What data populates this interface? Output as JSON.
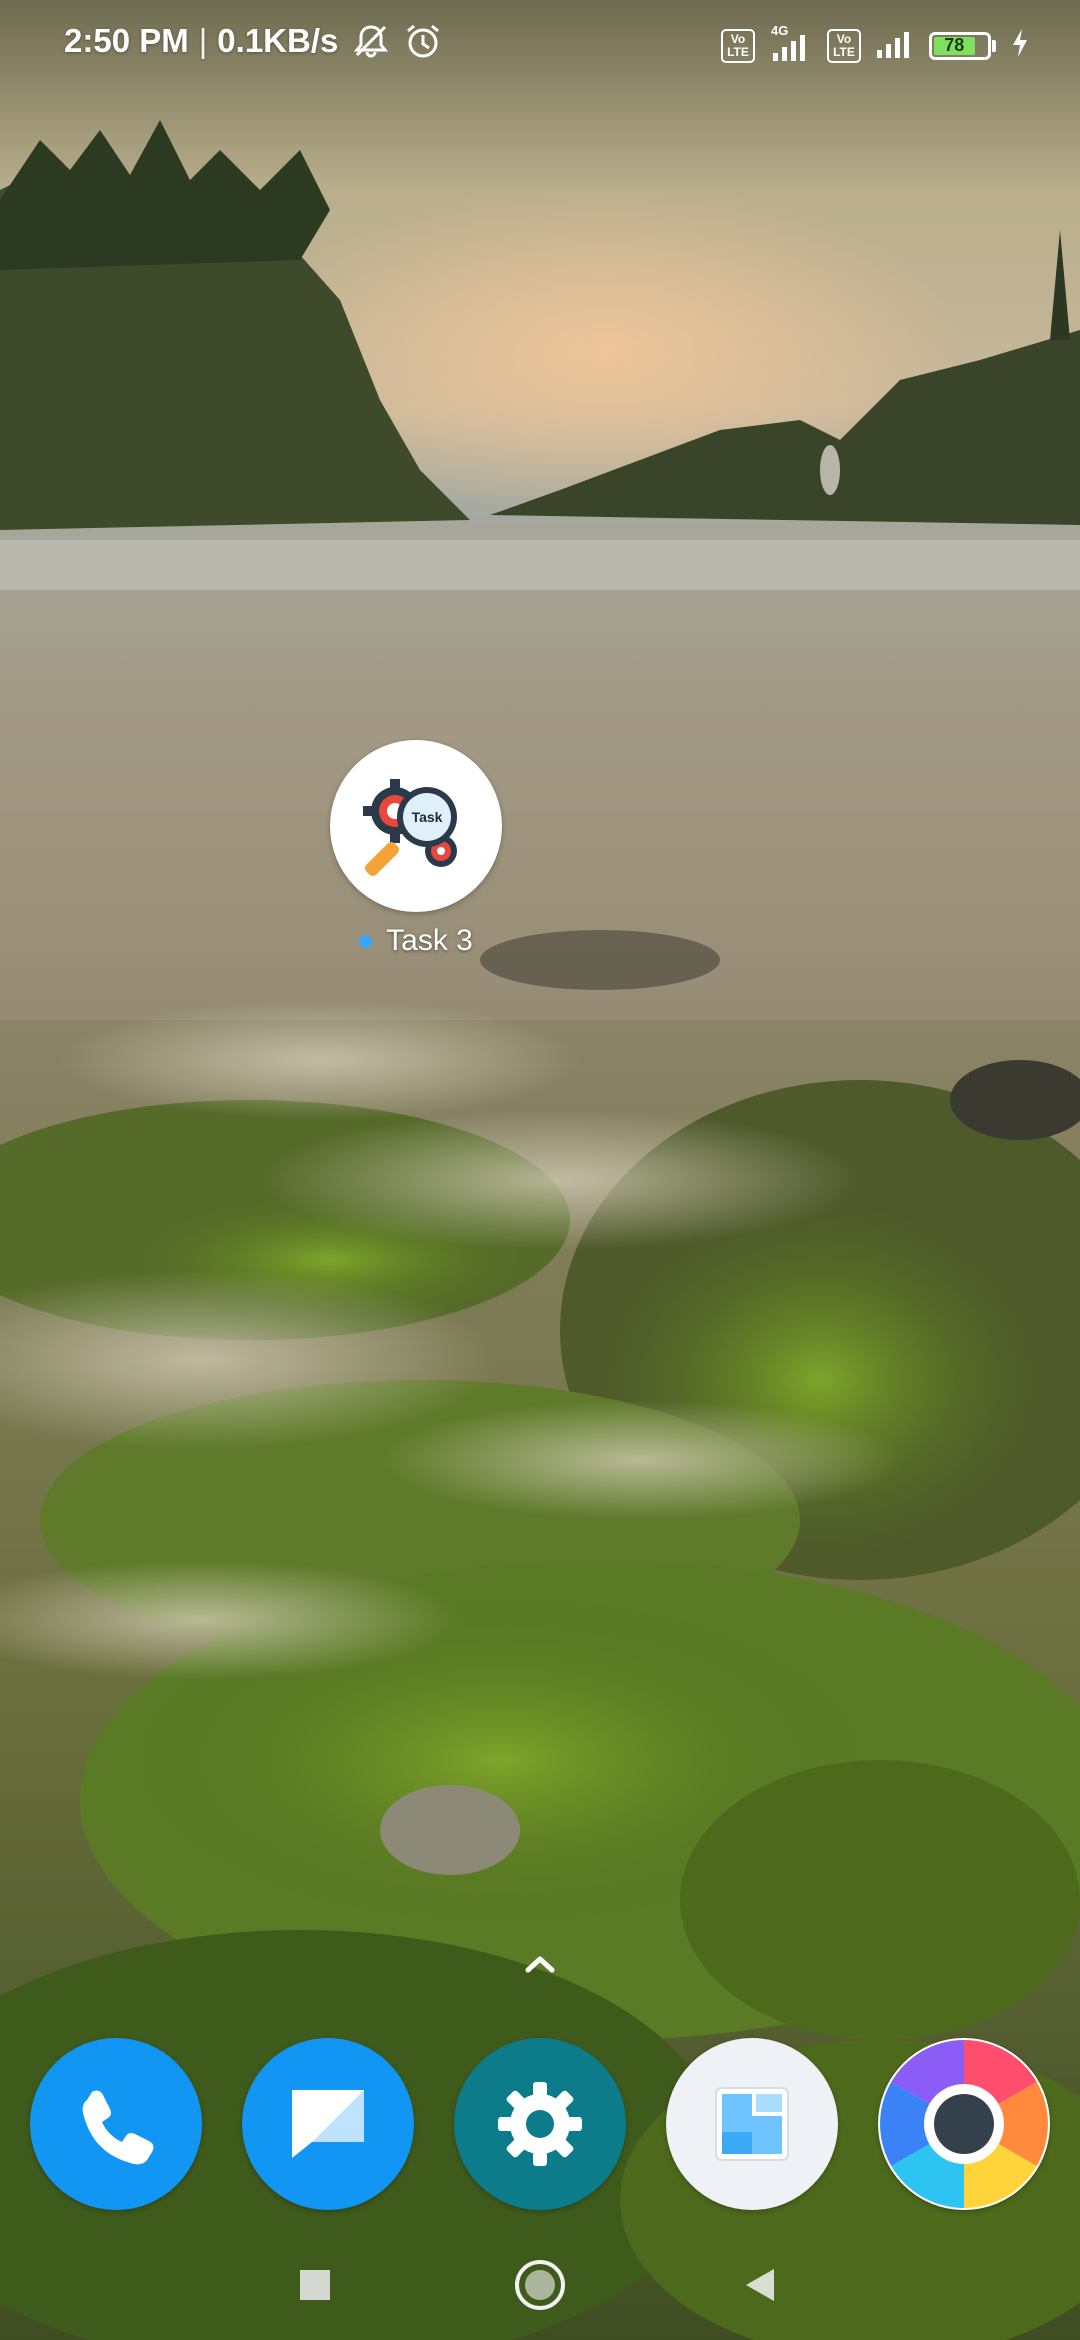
{
  "status_bar": {
    "time": "2:50 PM",
    "separator": "|",
    "net_speed": "0.1KB/s",
    "battery_level": "78",
    "icons": [
      "mute-icon",
      "alarm-icon",
      "volte-icon",
      "signal-4g-icon",
      "volte-icon",
      "signal-icon",
      "battery-icon",
      "charging-icon"
    ],
    "volte_top": "Vo",
    "volte_bottom": "LTE",
    "network_type": "4G"
  },
  "desktop": {
    "app": {
      "label": "Task 3",
      "icon": "task-gear-magnifier-icon",
      "icon_text": "Task",
      "new_indicator_color": "#37a6ff"
    }
  },
  "dock": {
    "apps": [
      {
        "name": "phone",
        "icon": "phone-icon",
        "color": "#1296f3"
      },
      {
        "name": "messages",
        "icon": "message-icon",
        "color": "#1296f3"
      },
      {
        "name": "settings",
        "icon": "gear-icon",
        "color": "#0c7b8a"
      },
      {
        "name": "gallery",
        "icon": "gallery-icon",
        "color": "#eef1f5"
      },
      {
        "name": "camera",
        "icon": "camera-icon",
        "color": "#ffffff"
      }
    ]
  },
  "nav_bar": {
    "buttons": [
      "recents-icon",
      "home-icon",
      "back-icon"
    ]
  },
  "colors": {
    "accent": "#37a6ff",
    "battery_fill": "#7ee05e"
  }
}
